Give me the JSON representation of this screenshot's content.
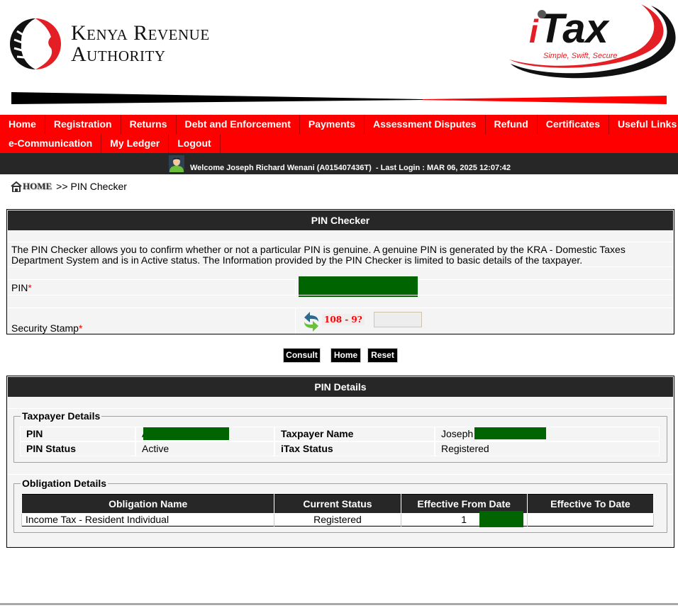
{
  "header": {
    "org_name_line1": "Kenya Revenue",
    "org_name_line2": "Authority",
    "app_logo_text": "iTax",
    "app_tagline": "Simple, Swift, Secure"
  },
  "nav": {
    "row1": [
      "Home",
      "Registration",
      "Returns",
      "Debt and Enforcement",
      "Payments",
      "Assessment Disputes",
      "Refund",
      "Certificates",
      "Useful Links"
    ],
    "row2": [
      "e-Communication",
      "My Ledger",
      "Logout"
    ]
  },
  "welcome": {
    "text": "Welcome Joseph Richard Wenani (A015407436T)  - Last Login : MAR 06, 2025 12:07:42"
  },
  "breadcrumb": {
    "home": "HOME",
    "separator": ">>",
    "current": "PIN Checker"
  },
  "pin_checker": {
    "title": "PIN Checker",
    "description": "The PIN Checker allows you to confirm whether or not a particular PIN is genuine. A genuine PIN is generated by the KRA - Domestic Taxes Department System and is in Active status. The Information provided by the PIN Checker is limited to basic details of the taxpayer.",
    "pin_label": "PIN",
    "required_marker": "*",
    "security_stamp_label": "Security Stamp",
    "captcha_question": "108 - 9?",
    "security_stamp_value": ""
  },
  "buttons": {
    "consult": "Consult",
    "home": "Home",
    "reset": "Reset"
  },
  "pin_details": {
    "title": "PIN Details",
    "taxpayer_legend": "Taxpayer Details",
    "taxpayer": {
      "pin_label": "PIN",
      "pin_value_prefix": "A",
      "name_label": "Taxpayer Name",
      "name_value_prefix": "Joseph",
      "pin_status_label": "PIN Status",
      "pin_status_value": "Active",
      "itax_status_label": "iTax Status",
      "itax_status_value": "Registered"
    },
    "obligation_legend": "Obligation Details",
    "obligation_columns": [
      "Obligation Name",
      "Current Status",
      "Effective From Date",
      "Effective To Date"
    ],
    "obligations": [
      {
        "name": "Income Tax - Resident Individual",
        "status": "Registered",
        "from": "1",
        "to": ""
      }
    ]
  },
  "colors": {
    "brand_red": "#ff0000",
    "dark_bar": "#272727",
    "redaction": "#006400"
  }
}
